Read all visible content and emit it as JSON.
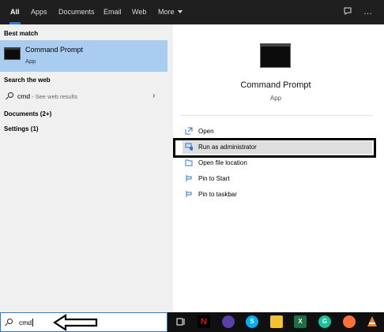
{
  "filters": {
    "all": "All",
    "apps": "Apps",
    "documents": "Documents",
    "email": "Email",
    "web": "Web",
    "more": "More"
  },
  "top_icons": {
    "feedback": "feedback-icon",
    "options": "…"
  },
  "left": {
    "best_match_header": "Best match",
    "best_match": {
      "title": "Command Prompt",
      "subtitle": "App"
    },
    "search_web_header": "Search the web",
    "web_result": {
      "query": "cmd",
      "suffix": " - See web results"
    },
    "documents_header": "Documents (2+)",
    "settings_header": "Settings (1)"
  },
  "right": {
    "app_name": "Command Prompt",
    "app_type": "App",
    "actions": [
      {
        "label": "Open",
        "icon": "open-icon"
      },
      {
        "label": "Run as administrator",
        "icon": "shield-icon"
      },
      {
        "label": "Open file location",
        "icon": "folder-icon"
      },
      {
        "label": "Pin to Start",
        "icon": "pin-icon"
      },
      {
        "label": "Pin to taskbar",
        "icon": "pin-icon"
      }
    ]
  },
  "taskbar": {
    "search_value": "cmd",
    "netflix_letter": "N",
    "skype_letter": "S",
    "excel_letter": "X",
    "grammarly_letter": "G"
  },
  "colors": {
    "accent": "#2b78d6",
    "selection": "#a8cdf0",
    "taskbar": "#101010"
  }
}
